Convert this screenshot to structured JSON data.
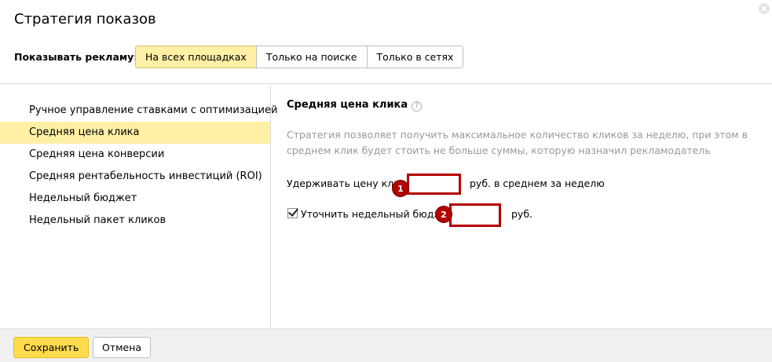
{
  "dialog": {
    "title": "Стратегия показов",
    "close_icon": "close-icon"
  },
  "show_ads": {
    "label": "Показывать рекламу:",
    "options": [
      {
        "label": "На всех площадках",
        "active": true
      },
      {
        "label": "Только на поиске",
        "active": false
      },
      {
        "label": "Только в сетях",
        "active": false
      }
    ]
  },
  "strategies": {
    "items": [
      {
        "label": "Ручное управление ставками с оптимизацией",
        "active": false
      },
      {
        "label": "Средняя цена клика",
        "active": true
      },
      {
        "label": "Средняя цена конверсии",
        "active": false
      },
      {
        "label": "Средняя рентабельность инвестиций (ROI)",
        "active": false
      },
      {
        "label": "Недельный бюджет",
        "active": false
      },
      {
        "label": "Недельный пакет кликов",
        "active": false
      }
    ]
  },
  "detail": {
    "title": "Средняя цена клика",
    "help_icon": "?",
    "description": "Стратегия позволяет получить максимальное количество кликов за неделю, при этом в среднем клик будет стоить не больше суммы, которую назначил рекламодатель",
    "avg_price": {
      "label": "Удерживать цену клика",
      "value": "",
      "unit": "руб. в среднем за неделю",
      "badge": "1"
    },
    "weekly_budget": {
      "checked": true,
      "label": "Уточнить недельный бюджет",
      "value": "",
      "unit": "руб.",
      "badge": "2"
    }
  },
  "footer": {
    "save_label": "Сохранить",
    "cancel_label": "Отмена"
  },
  "colors": {
    "accent_yellow": "#ffdb4d",
    "selected_bg": "#fff0a5",
    "highlight_red": "#b30000"
  }
}
